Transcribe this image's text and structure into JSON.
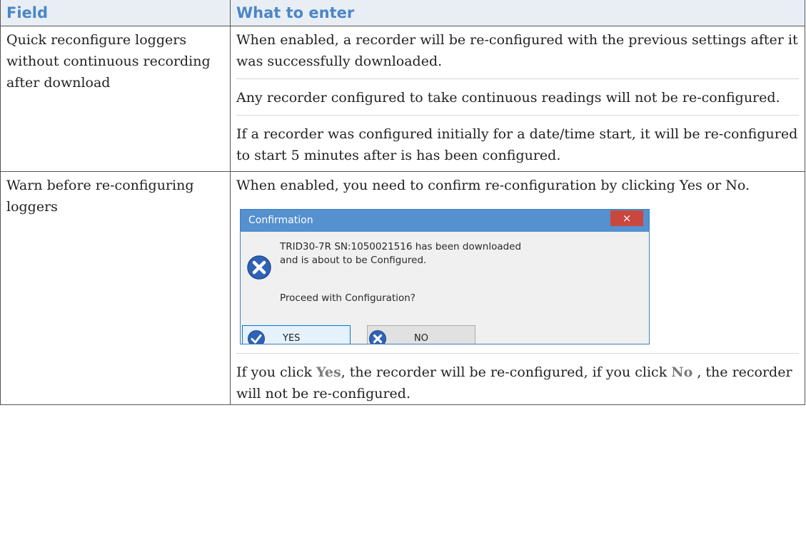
{
  "table": {
    "headers": {
      "field": "Field",
      "what": "What to enter"
    },
    "rows": [
      {
        "field": "Quick reconfigure loggers without continuous recording after download",
        "paras": [
          "When enabled, a recorder will be re-configured with the previous settings after it was successfully downloaded.",
          "Any recorder configured to take continuous readings will not be re-configured.",
          "If a recorder was configured initially for a date/time start, it will be re-configured to start 5 minutes after is has been configured."
        ]
      },
      {
        "field": "Warn before re-configuring loggers",
        "paras": [
          "When enabled, you need to confirm re-configuration by clicking Yes or No."
        ],
        "after": {
          "prefix": "If you click ",
          "yes": "Yes",
          "middle": ", the recorder will be re-configured, if you click ",
          "no": "No",
          "suffix": " , the recorder will not be re-configured."
        }
      }
    ]
  },
  "dialog": {
    "title": "Confirmation",
    "close_glyph": "×",
    "message_line1": "TRID30-7R  SN:1050021516  has been downloaded",
    "message_line2": "and is about to be Configured.",
    "question": "Proceed with Configuration?",
    "yes_label": "YES",
    "no_label": "NO",
    "icons": {
      "message": "error-x-icon",
      "yes": "checkmark-icon",
      "no": "error-x-icon"
    },
    "colors": {
      "titlebar": "#5590cf",
      "close": "#c9473d",
      "icon": "#2f63b5"
    }
  }
}
